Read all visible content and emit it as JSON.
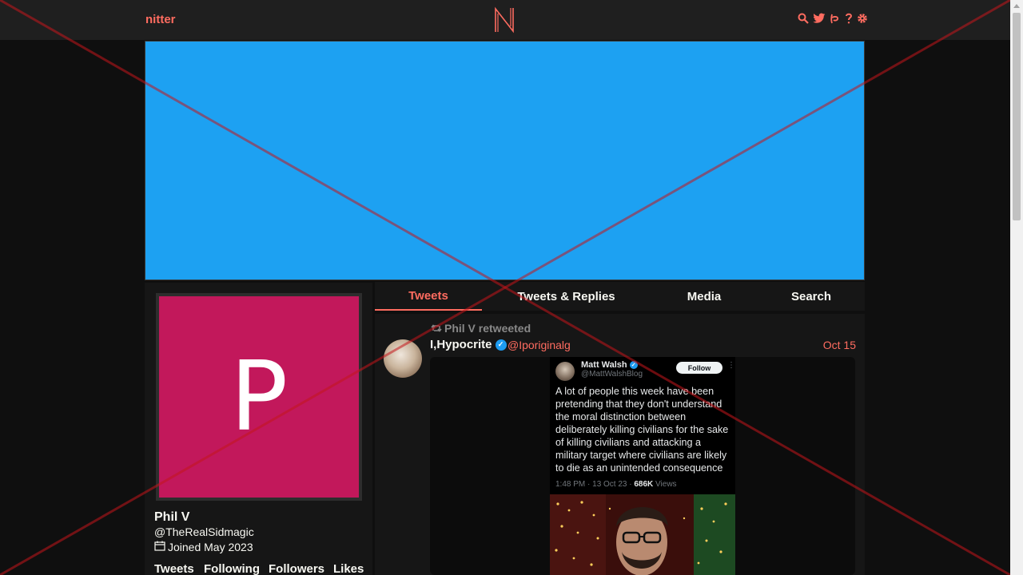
{
  "nav": {
    "brand": "nitter",
    "logo_letter": "N",
    "icons": [
      "search-icon",
      "twitter-bird-icon",
      "rss-icon",
      "help-icon",
      "gear-icon"
    ],
    "accent_color": "#ff6c60"
  },
  "banner": {
    "color": "#1da1f2"
  },
  "profile": {
    "avatar_letter": "P",
    "avatar_color": "#c2185b",
    "name": "Phil V",
    "handle": "@TheRealSidmagic",
    "joined": "Joined May 2023",
    "stats": [
      "Tweets",
      "Following",
      "Followers",
      "Likes"
    ]
  },
  "tabs": [
    {
      "label": "Tweets",
      "active": true
    },
    {
      "label": "Tweets & Replies",
      "active": false
    },
    {
      "label": "Media",
      "active": false
    },
    {
      "label": "Search",
      "active": false
    }
  ],
  "tweet": {
    "retweet_header": "Phil V retweeted",
    "name": "I,Hypocrite",
    "username": "@Iporiginalg",
    "date": "Oct 15",
    "embed": {
      "name": "Matt Walsh",
      "handle": "@MattWalshBlog",
      "follow_label": "Follow",
      "text": "A lot of people this week have been pretending that they don't understand the moral distinction between deliberately killing civilians for the sake of killing civilians and attacking a military target where civilians are likely to die as an unintended consequence",
      "meta_prefix": "1:48 PM · 13 Oct 23 · ",
      "views_count": "686K",
      "views_label": " Views"
    }
  }
}
